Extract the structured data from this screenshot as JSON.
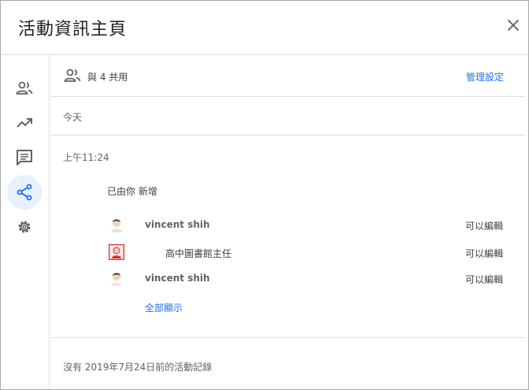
{
  "header": {
    "title": "活動資訊主頁"
  },
  "share": {
    "text": "與 4 共用",
    "manage_label": "管理設定"
  },
  "sections": {
    "today_label": "今天",
    "time": "上午11:24",
    "action_text": "已由你 新增"
  },
  "people": [
    {
      "name": "vincent shih",
      "permission": "可以編輯"
    },
    {
      "name": "高中圖書館主任",
      "permission": "可以編輯"
    },
    {
      "name": "vincent shih",
      "permission": "可以編輯"
    }
  ],
  "show_all_label": "全部顯示",
  "footer_note": "沒有 2019年7月24日前的活動記錄",
  "colors": {
    "accent": "#1a73e8",
    "active_nav_bg": "#e8f0fe",
    "divider": "#dadce0"
  },
  "nav_icons": [
    "people-icon",
    "trending-up-icon",
    "comment-icon",
    "share-icon",
    "gear-icon"
  ]
}
